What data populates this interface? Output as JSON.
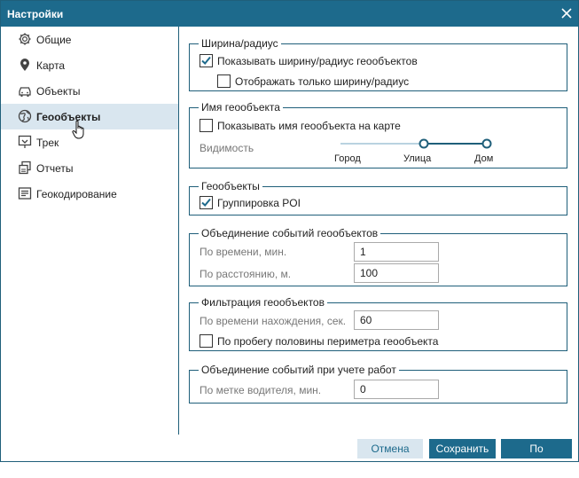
{
  "window": {
    "title": "Настройки"
  },
  "sidebar": {
    "items": [
      {
        "label": "Общие",
        "icon": "gear-icon"
      },
      {
        "label": "Карта",
        "icon": "map-pin-icon"
      },
      {
        "label": "Объекты",
        "icon": "car-icon"
      },
      {
        "label": "Геообъекты",
        "icon": "globe-icon",
        "active": true
      },
      {
        "label": "Трек",
        "icon": "track-icon"
      },
      {
        "label": "Отчеты",
        "icon": "reports-icon"
      },
      {
        "label": "Геокодирование",
        "icon": "geocoding-icon"
      }
    ]
  },
  "width_radius": {
    "legend": "Ширина/радиус",
    "show_width_radius": {
      "label": "Показывать ширину/радиус геообъектов",
      "checked": true
    },
    "only_width_radius": {
      "label": "Отображать только ширину/радиус",
      "checked": false
    }
  },
  "geofence_name": {
    "legend": "Имя геообъекта",
    "show_name": {
      "label": "Показывать имя геообъекта на карте",
      "checked": false
    },
    "visibility_label": "Видимость",
    "slider_stops": [
      "Город",
      "Улица",
      "Дом"
    ],
    "slider_selected": "Улица"
  },
  "geofences": {
    "legend": "Геообъекты",
    "poi_grouping": {
      "label": "Группировка POI",
      "checked": true
    }
  },
  "events_merge": {
    "legend": "Объединение событий геообъектов",
    "by_time": {
      "label": "По времени, мин.",
      "value": "1"
    },
    "by_distance": {
      "label": "По расстоянию, м.",
      "value": "100"
    }
  },
  "filtering": {
    "legend": "Фильтрация геообъектов",
    "by_stay_time": {
      "label": "По времени нахождения, сек.",
      "value": "60"
    },
    "half_perimeter": {
      "label": "По пробегу половины периметра геообъекта",
      "checked": false
    }
  },
  "work_merge": {
    "legend": "Объединение событий при учете работ",
    "driver_tag": {
      "label": "По метке водителя, мин.",
      "value": "0"
    }
  },
  "footer": {
    "cancel_label": "Отмена",
    "save_label": "Сохранить",
    "default_label": "По умолчанию"
  },
  "colors": {
    "accent": "#1d6a8c",
    "active_bg": "#d9e6ef",
    "slider_track": "#b9d3e0"
  }
}
